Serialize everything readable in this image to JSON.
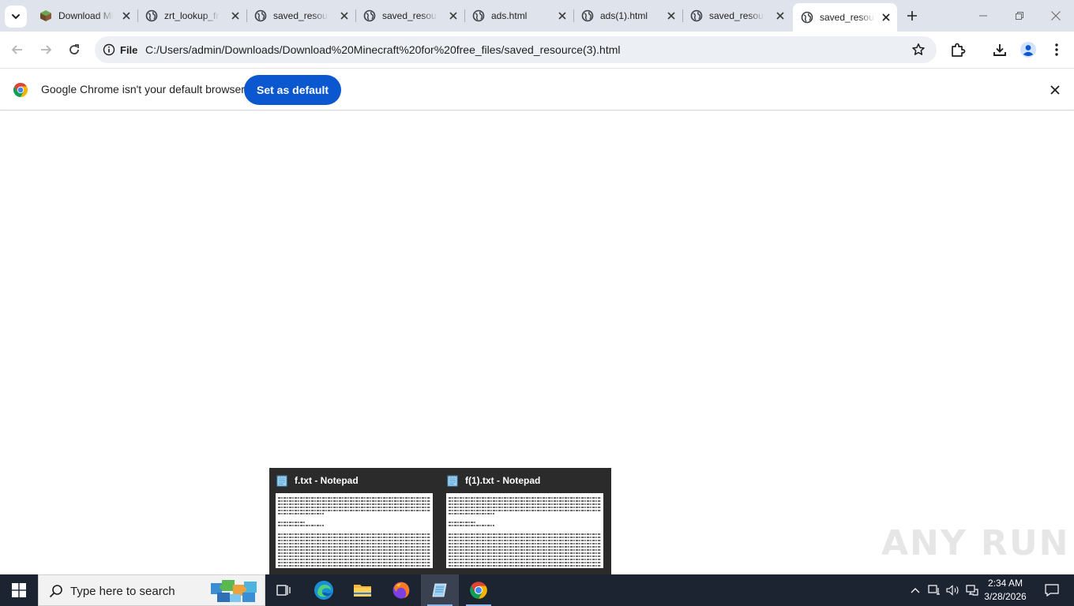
{
  "browser": {
    "tabs": [
      {
        "title": "Download Minecraft for free",
        "favicon": "minecraft-block-icon",
        "active": false
      },
      {
        "title": "zrt_lookup_frame",
        "favicon": "globe-icon",
        "active": false
      },
      {
        "title": "saved_resource",
        "favicon": "globe-icon",
        "active": false
      },
      {
        "title": "saved_resource",
        "favicon": "globe-icon",
        "active": false
      },
      {
        "title": "ads.html",
        "favicon": "globe-icon",
        "active": false
      },
      {
        "title": "ads(1).html",
        "favicon": "globe-icon",
        "active": false
      },
      {
        "title": "saved_resource",
        "favicon": "globe-icon",
        "active": false
      },
      {
        "title": "saved_resource",
        "favicon": "globe-icon",
        "active": true
      }
    ],
    "omnibox": {
      "scheme_label": "File",
      "url": "C:/Users/admin/Downloads/Download%20Minecraft%20for%20free_files/saved_resource(3).html"
    },
    "infobar": {
      "message": "Google Chrome isn't your default browser",
      "button_label": "Set as default"
    },
    "colors": {
      "tabstrip": "#dfe3eb",
      "omnibox": "#eceff4",
      "accent_button": "#0b57d0",
      "taskbar": "#1c2331"
    }
  },
  "taskbar_preview": {
    "windows": [
      {
        "title": "f.txt - Notepad",
        "icon": "notepad-icon"
      },
      {
        "title": "f(1).txt - Notepad",
        "icon": "notepad-icon"
      }
    ]
  },
  "watermark": {
    "text": "ANY RUN"
  },
  "taskbar": {
    "search_placeholder": "Type here to search",
    "apps": [
      "task-view-icon",
      "edge-icon",
      "file-explorer-icon",
      "firefox-icon",
      "notepad-icon",
      "chrome-icon"
    ],
    "clock_time": "2:34 AM",
    "clock_date": "3/28/2026"
  }
}
